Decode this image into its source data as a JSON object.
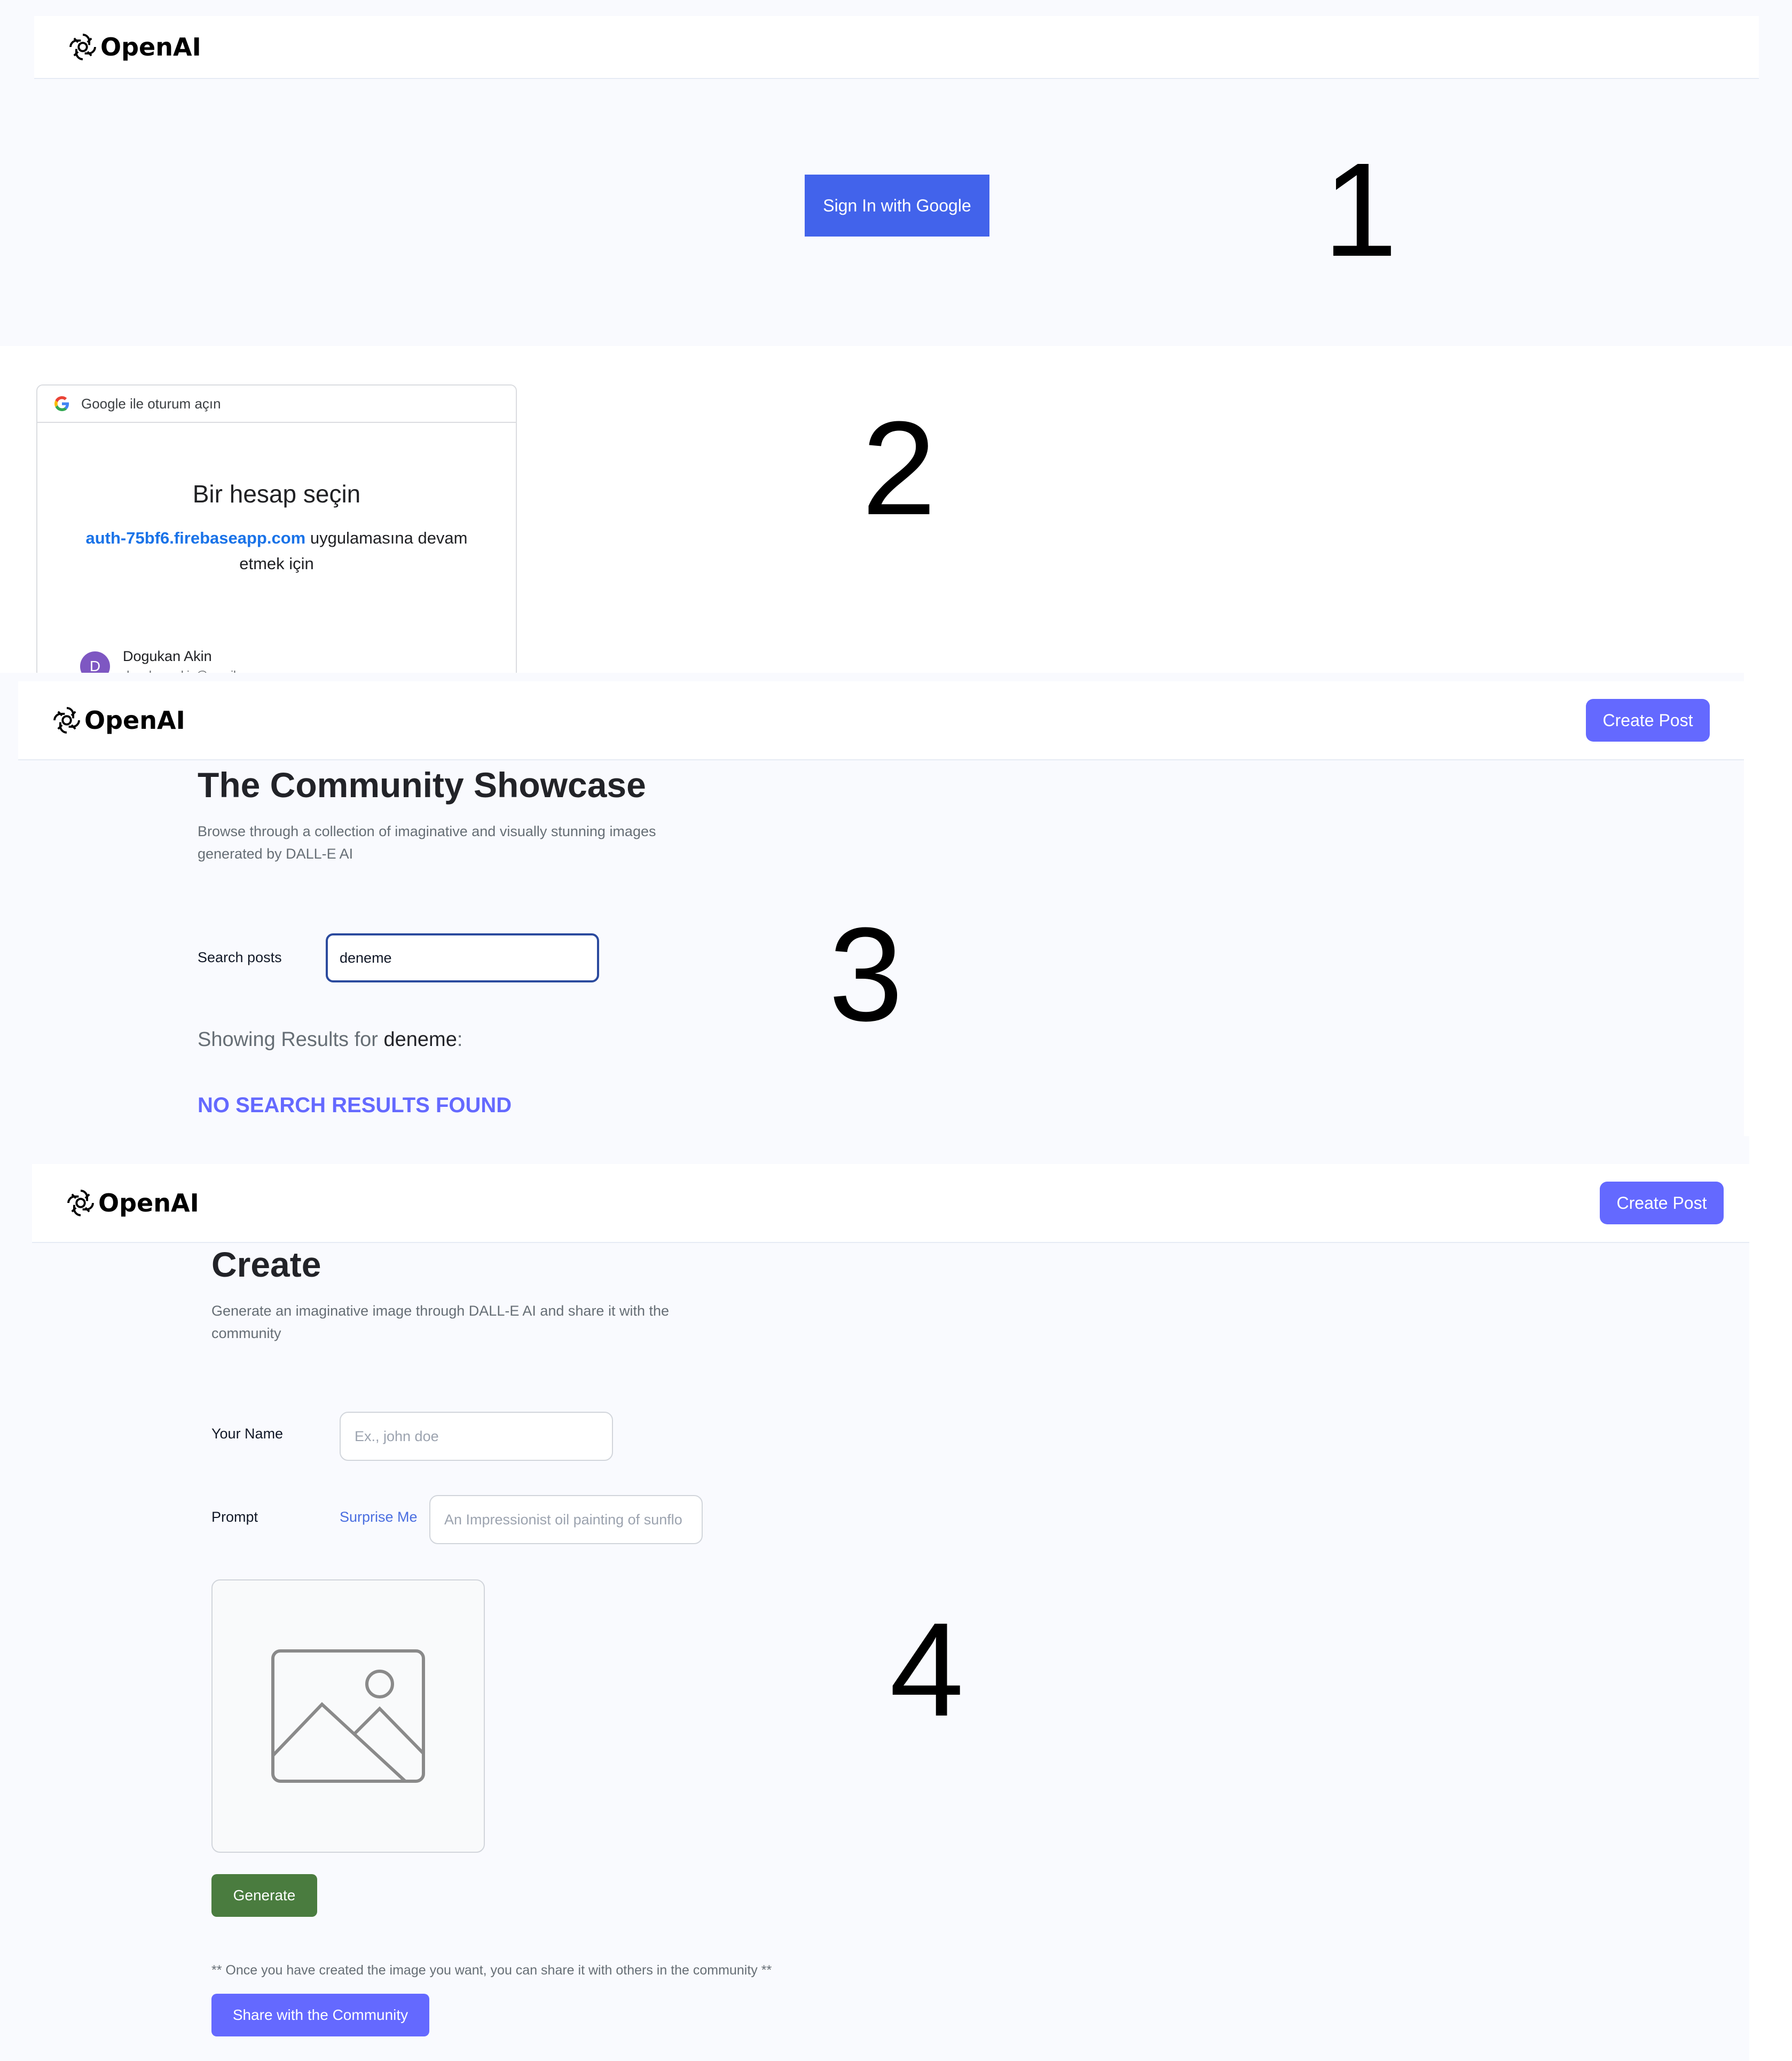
{
  "panel1": {
    "logo_text": "OpenAI",
    "sign_in_label": "Sign In with Google",
    "step_number": "1"
  },
  "panel2": {
    "window_title": "Google ile oturum açın",
    "heading": "Bir hesap seçin",
    "app_domain": "auth-75bf6.firebaseapp.com",
    "continue_text_1": " uygulamasına devam",
    "continue_text_2": "etmek için",
    "account": {
      "avatar_letter": "D",
      "name": "Dogukan Akin",
      "email": "dogukannakin@gmail.com"
    },
    "step_number": "2"
  },
  "panel3": {
    "logo_text": "OpenAI",
    "create_post_label": "Create Post",
    "title": "The Community Showcase",
    "subtitle_line1": "Browse through a collection of imaginative and visually stunning images",
    "subtitle_line2": "generated by DALL-E AI",
    "search_label": "Search posts",
    "search_value": "deneme",
    "results_prefix": "Showing Results for ",
    "results_query": "deneme",
    "results_suffix": ":",
    "no_results": "NO SEARCH RESULTS FOUND",
    "step_number": "3"
  },
  "panel4": {
    "logo_text": "OpenAI",
    "create_post_label": "Create Post",
    "title": "Create",
    "subtitle_line1": "Generate an imaginative image through DALL-E AI and share it with the",
    "subtitle_line2": "community",
    "name_label": "Your Name",
    "name_placeholder": "Ex., john doe",
    "prompt_label": "Prompt",
    "surprise_label": "Surprise Me",
    "prompt_placeholder": "An Impressionist oil painting of sunflo",
    "generate_label": "Generate",
    "share_note": "** Once you have created the image you want, you can share it with others in the community **",
    "share_label": "Share with the Community",
    "step_number": "4"
  },
  "colors": {
    "google_blue": "#4263eb",
    "primary": "#6469ff",
    "green": "#4a7c3f",
    "link_blue": "#1a56db",
    "no_results": "#6469ff"
  }
}
